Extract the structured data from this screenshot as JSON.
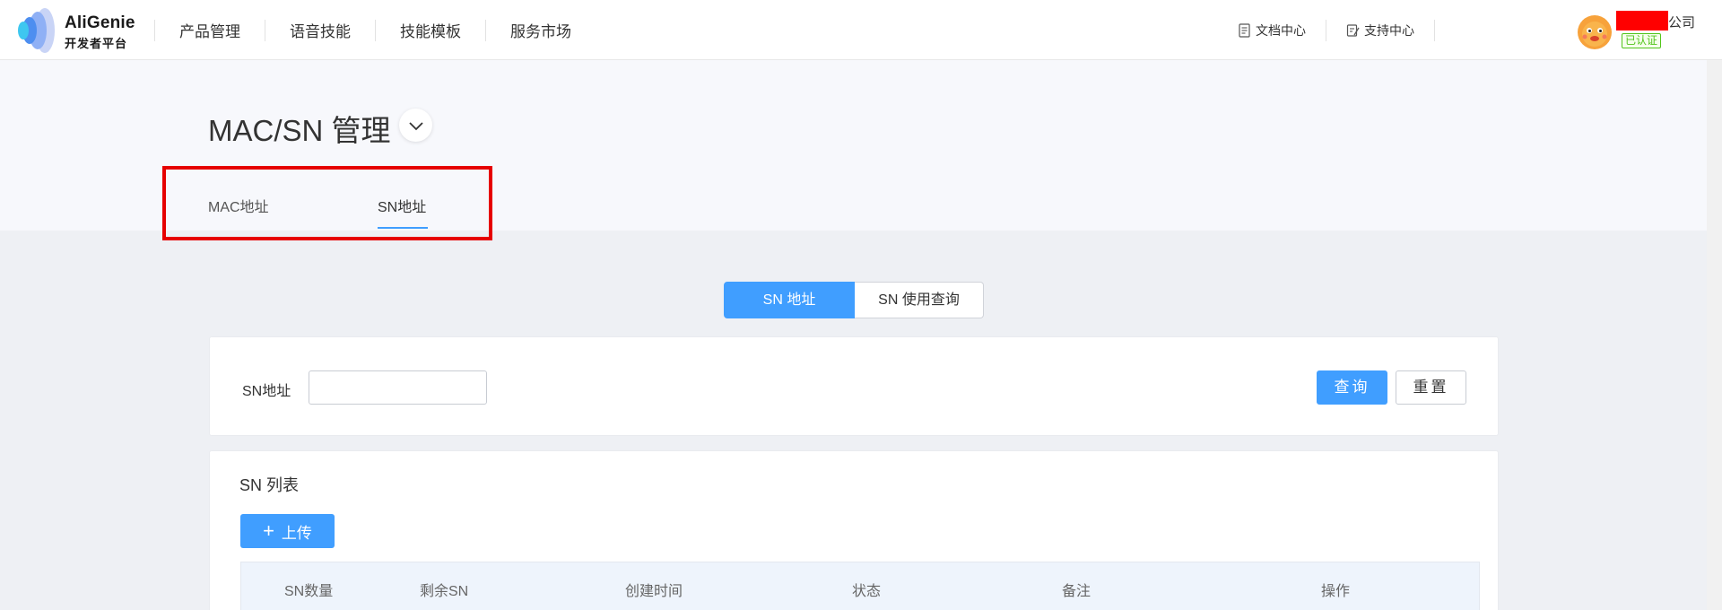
{
  "topbar": {
    "logo_title": "AliGenie",
    "logo_subtitle": "开发者平台",
    "nav": [
      {
        "label": "产品管理"
      },
      {
        "label": "语音技能"
      },
      {
        "label": "技能模板"
      },
      {
        "label": "服务市场"
      }
    ],
    "links": [
      {
        "label": "文档中心",
        "icon": "document-icon"
      },
      {
        "label": "支持中心",
        "icon": "support-edit-icon"
      }
    ],
    "user": {
      "company_suffix": "公司",
      "verified_label": "已认证",
      "avatar_icon": "avatar-cartoon"
    }
  },
  "page": {
    "title": "MAC/SN 管理",
    "tabs": [
      {
        "label": "MAC地址",
        "active": false
      },
      {
        "label": "SN地址",
        "active": true
      }
    ]
  },
  "segment": {
    "options": [
      {
        "label": "SN 地址",
        "active": true
      },
      {
        "label": "SN 使用查询",
        "active": false
      }
    ]
  },
  "query": {
    "field_label": "SN地址",
    "field_value": "",
    "query_button": "查询",
    "reset_button": "重置"
  },
  "list": {
    "title": "SN 列表",
    "upload_button": "上传",
    "columns": [
      "SN数量",
      "剩余SN",
      "创建时间",
      "状态",
      "备注",
      "操作"
    ]
  },
  "colors": {
    "primary": "#409eff",
    "highlight": "#e60000",
    "verified": "#52c41a"
  }
}
